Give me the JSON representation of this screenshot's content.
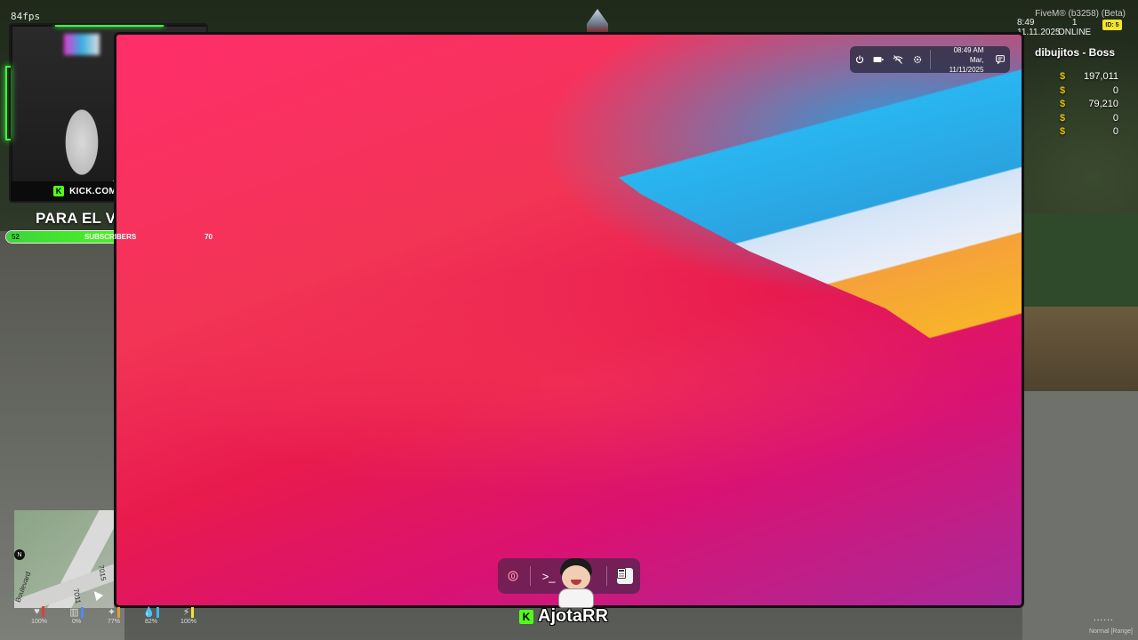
{
  "hud": {
    "fps": "84fps",
    "server_title": "FiveM® (b3258) (Beta)",
    "clock_time": "8:49",
    "clock_date": "11.11.2025",
    "players_online_count": "1",
    "players_online_label": "ONLINE",
    "player_id": "ID: 5"
  },
  "stream": {
    "channel": "KICK.COM/AJOTARR",
    "goal_title": "PARA EL VIAJE A PERÚ",
    "goal_current": "52",
    "goal_label": "SUBSCRIBERS",
    "goal_target": "70",
    "goal_progress_fraction": 0.74,
    "brand_name": "AjotaRR",
    "kick_letter": "K"
  },
  "player": {
    "job": "dibujitos - Boss",
    "money": [
      {
        "symbol": "$",
        "value": "197,011"
      },
      {
        "symbol": "$",
        "value": "0"
      },
      {
        "symbol": "$",
        "value": "79,210"
      },
      {
        "symbol": "$",
        "value": "0"
      },
      {
        "symbol": "$",
        "value": "0"
      }
    ]
  },
  "laptop": {
    "status_time": "08:49 AM",
    "status_date": "Mar, 11/11/2025",
    "status_icons": [
      "power-icon",
      "battery-icon",
      "wifi-off-icon",
      "settings-icon"
    ],
    "dock_apps": [
      "power-app-icon",
      "terminal-icon",
      "calculator-icon"
    ],
    "terminal_glyph": ">_"
  },
  "minimap": {
    "compass": "N",
    "street_1": "7011",
    "street_2": "7015",
    "street_3": "Boulevard"
  },
  "vitals": [
    {
      "name": "health",
      "pct": "100%",
      "color": "#e23b3b"
    },
    {
      "name": "armor",
      "pct": "0%",
      "color": "#4a8cff"
    },
    {
      "name": "hunger",
      "pct": "77%",
      "color": "#e0a030"
    },
    {
      "name": "thirst",
      "pct": "82%",
      "color": "#3fb5ff"
    },
    {
      "name": "stamina",
      "pct": "100%",
      "color": "#f5e52a"
    }
  ],
  "voice": {
    "dots": "......",
    "mode": "Normal [Range]"
  }
}
